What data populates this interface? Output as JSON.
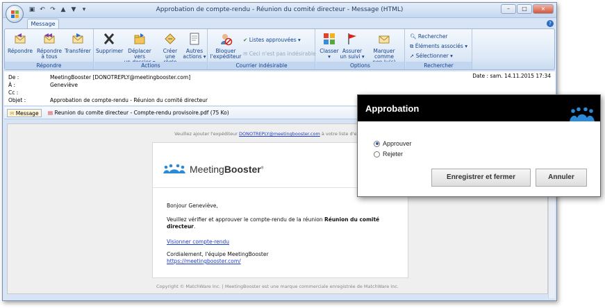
{
  "window": {
    "title": "Approbation de compte-rendu - Réunion du comité directeur - Message (HTML)",
    "controls": [
      "–",
      "□",
      "×"
    ]
  },
  "tabs": [
    {
      "label": "Message"
    }
  ],
  "ribbon": {
    "groups": [
      {
        "label": "Répondre",
        "buttons": [
          {
            "label1": "Répondre",
            "label2": "",
            "icon": "reply-icon"
          },
          {
            "label1": "Répondre",
            "label2": "à tous",
            "icon": "reply-all-icon"
          },
          {
            "label1": "Transférer",
            "label2": "",
            "icon": "forward-icon"
          }
        ]
      },
      {
        "label": "Actions",
        "buttons": [
          {
            "label1": "Supprimer",
            "label2": "",
            "icon": "delete-icon"
          },
          {
            "label1": "Déplacer vers",
            "label2": "un dossier ▾",
            "icon": "move-folder-icon"
          },
          {
            "label1": "Créer",
            "label2": "une règle",
            "icon": "rule-icon"
          },
          {
            "label1": "Autres",
            "label2": "actions ▾",
            "icon": "other-actions-icon"
          }
        ]
      },
      {
        "label": "Courrier indésirable",
        "buttons": [
          {
            "label1": "Bloquer",
            "label2": "l'expéditeur",
            "icon": "block-sender-icon"
          }
        ],
        "small": [
          {
            "label": "Listes approuvées ▾",
            "disabled": false
          },
          {
            "label": "Ceci n'est pas indésirable",
            "disabled": true
          }
        ]
      },
      {
        "label": "Options",
        "buttons": [
          {
            "label1": "Classer",
            "label2": "▾",
            "icon": "categorize-icon"
          },
          {
            "label1": "Assurer",
            "label2": "un suivi ▾",
            "icon": "follow-up-flag-icon"
          },
          {
            "label1": "Marquer comme",
            "label2": "non lu(s)",
            "icon": "mark-unread-icon"
          }
        ]
      },
      {
        "label": "Rechercher",
        "small": [
          {
            "label": "Rechercher",
            "disabled": false
          },
          {
            "label": "Éléments associés ▾",
            "disabled": false
          },
          {
            "label": "Sélectionner ▾",
            "disabled": false
          }
        ]
      }
    ]
  },
  "headers": {
    "from": {
      "key": "De :",
      "value": "MeetingBooster [DONOTREPLY@meetingbooster.com]"
    },
    "to": {
      "key": "À :",
      "value": "Geneviève"
    },
    "cc": {
      "key": "Cc :",
      "value": ""
    },
    "subject": {
      "key": "Objet :",
      "value": "Approbation de compte-rendu - Réunion du comité directeur"
    },
    "date": "Date :   sam. 14.11.2015 17:34"
  },
  "attachments": {
    "message": "Message",
    "file": "Reunion du comite directeur - Compte-rendu provisoire.pdf (75 Ko)"
  },
  "email": {
    "notice_prefix": "Veuillez ajouter l'expéditeur ",
    "notice_link": "DONOTREPLY@meetingbooster.com",
    "notice_suffix": " à votre liste d'expéditeurs",
    "brand_normal": "Meeting",
    "brand_bold": "Booster",
    "brand_mark": "®",
    "greeting": "Bonjour Geneviève,",
    "line1_prefix": "Veuillez vérifier et approuver le compte-rendu de la réunion ",
    "line1_bold": "Réunion du comité",
    "line1_bold2": "directeur",
    "line1_suffix": ".",
    "link": "Visionner compte-rendu",
    "signoff": "Cordialement, l'équipe MeetingBooster",
    "site": "https://meetingbooster.com/",
    "copyright": "Copyright © MatchWare Inc. | MeetingBooster est une marque commerciale enregistrée de MatchWare Inc."
  },
  "dialog": {
    "title": "Approbation",
    "options": [
      {
        "label": "Approuver",
        "selected": true
      },
      {
        "label": "Rejeter",
        "selected": false
      }
    ],
    "save_button": "Enregistrer et fermer",
    "cancel_button": "Annuler"
  }
}
